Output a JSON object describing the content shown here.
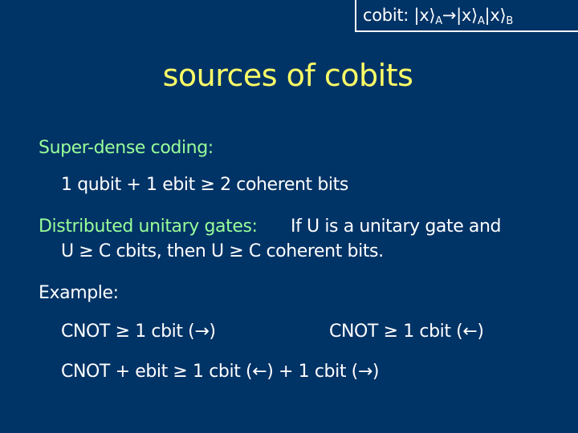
{
  "corner_box": {
    "label": "cobit:",
    "ket1": "|x⟩",
    "sub1": "A",
    "arrow": "→",
    "ket2": "|x⟩",
    "sub2": "A",
    "ket3": "|x⟩",
    "sub3": "B"
  },
  "title": "sources of cobits",
  "sections": {
    "superdense": {
      "heading": "Super-dense coding:",
      "statement": "1 qubit + 1 ebit ≥ 2 coherent bits"
    },
    "distributed": {
      "heading": "Distributed unitary gates:",
      "statement_line1": "If U is a unitary gate and",
      "statement_line2": "U ≥ C cbits, then U ≥ C coherent bits."
    },
    "example": {
      "heading": "Example:",
      "item1": "CNOT ≥ 1 cbit (→)",
      "item2": "CNOT ≥ 1 cbit (←)",
      "item3": "CNOT + ebit ≥ 1 cbit (←) + 1 cbit (→)"
    }
  },
  "colors": {
    "background": "#003366",
    "title": "#ffff66",
    "heading": "#99ff99",
    "text": "#ffffff"
  }
}
